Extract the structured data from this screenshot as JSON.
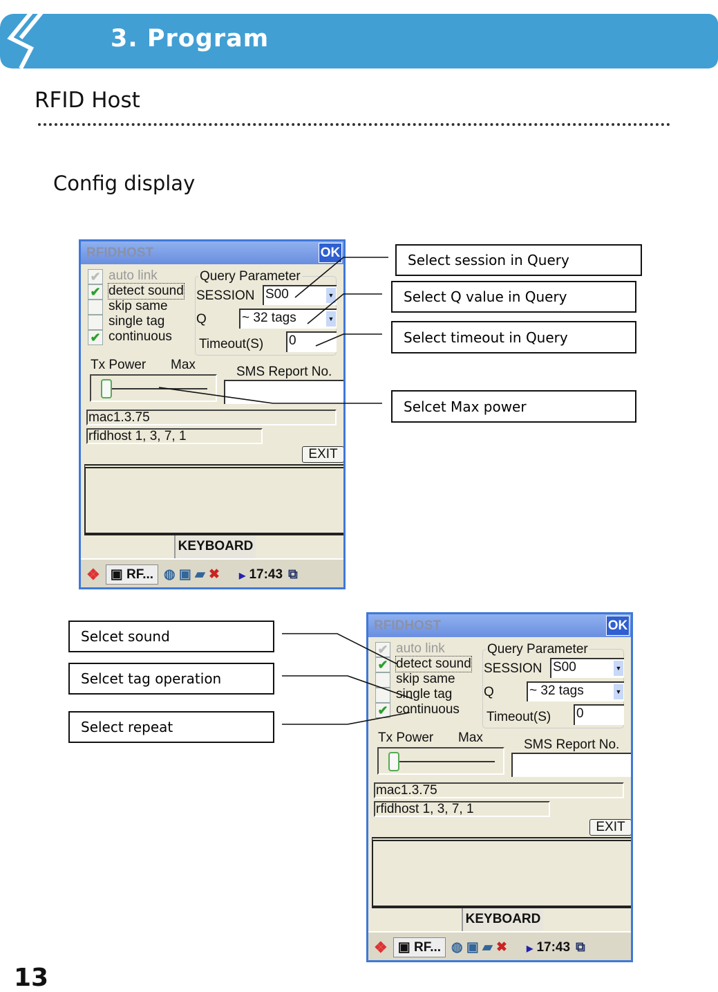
{
  "header": {
    "title": "3. Program"
  },
  "section_title": "RFID Host",
  "subtitle": "Config display",
  "page_number": "13",
  "device": {
    "title": "RFIDHOST",
    "ok_label": "OK",
    "checkboxes": [
      {
        "label": "auto link",
        "checked": true,
        "disabled": true
      },
      {
        "label": "detect sound",
        "checked": true
      },
      {
        "label": "skip same",
        "checked": false
      },
      {
        "label": "single tag",
        "checked": false
      },
      {
        "label": "continuous",
        "checked": true
      }
    ],
    "query_group": "Query Parameter",
    "session_label": "SESSION",
    "session_value": "S00",
    "q_label": "Q",
    "q_value": "~ 32 tags",
    "timeout_label": "Timeout(S)",
    "timeout_value": "0",
    "tx_power_label": "Tx Power",
    "tx_power_max": "Max",
    "sms_label": "SMS Report No.",
    "sms_value": "",
    "mac_value": "mac1.3.75",
    "version_value": "rfidhost 1, 3, 7, 1",
    "exit_label": "EXIT",
    "keyboard_label": "KEYBOARD",
    "taskbar_app": "RF...",
    "clock": "17:43"
  },
  "callouts_top": [
    "Select session in Query",
    "Select Q value in Query",
    "Select timeout in Query",
    "Selcet Max power"
  ],
  "callouts_bottom": [
    "Selcet sound",
    "Selcet tag operation",
    "Select repeat"
  ]
}
